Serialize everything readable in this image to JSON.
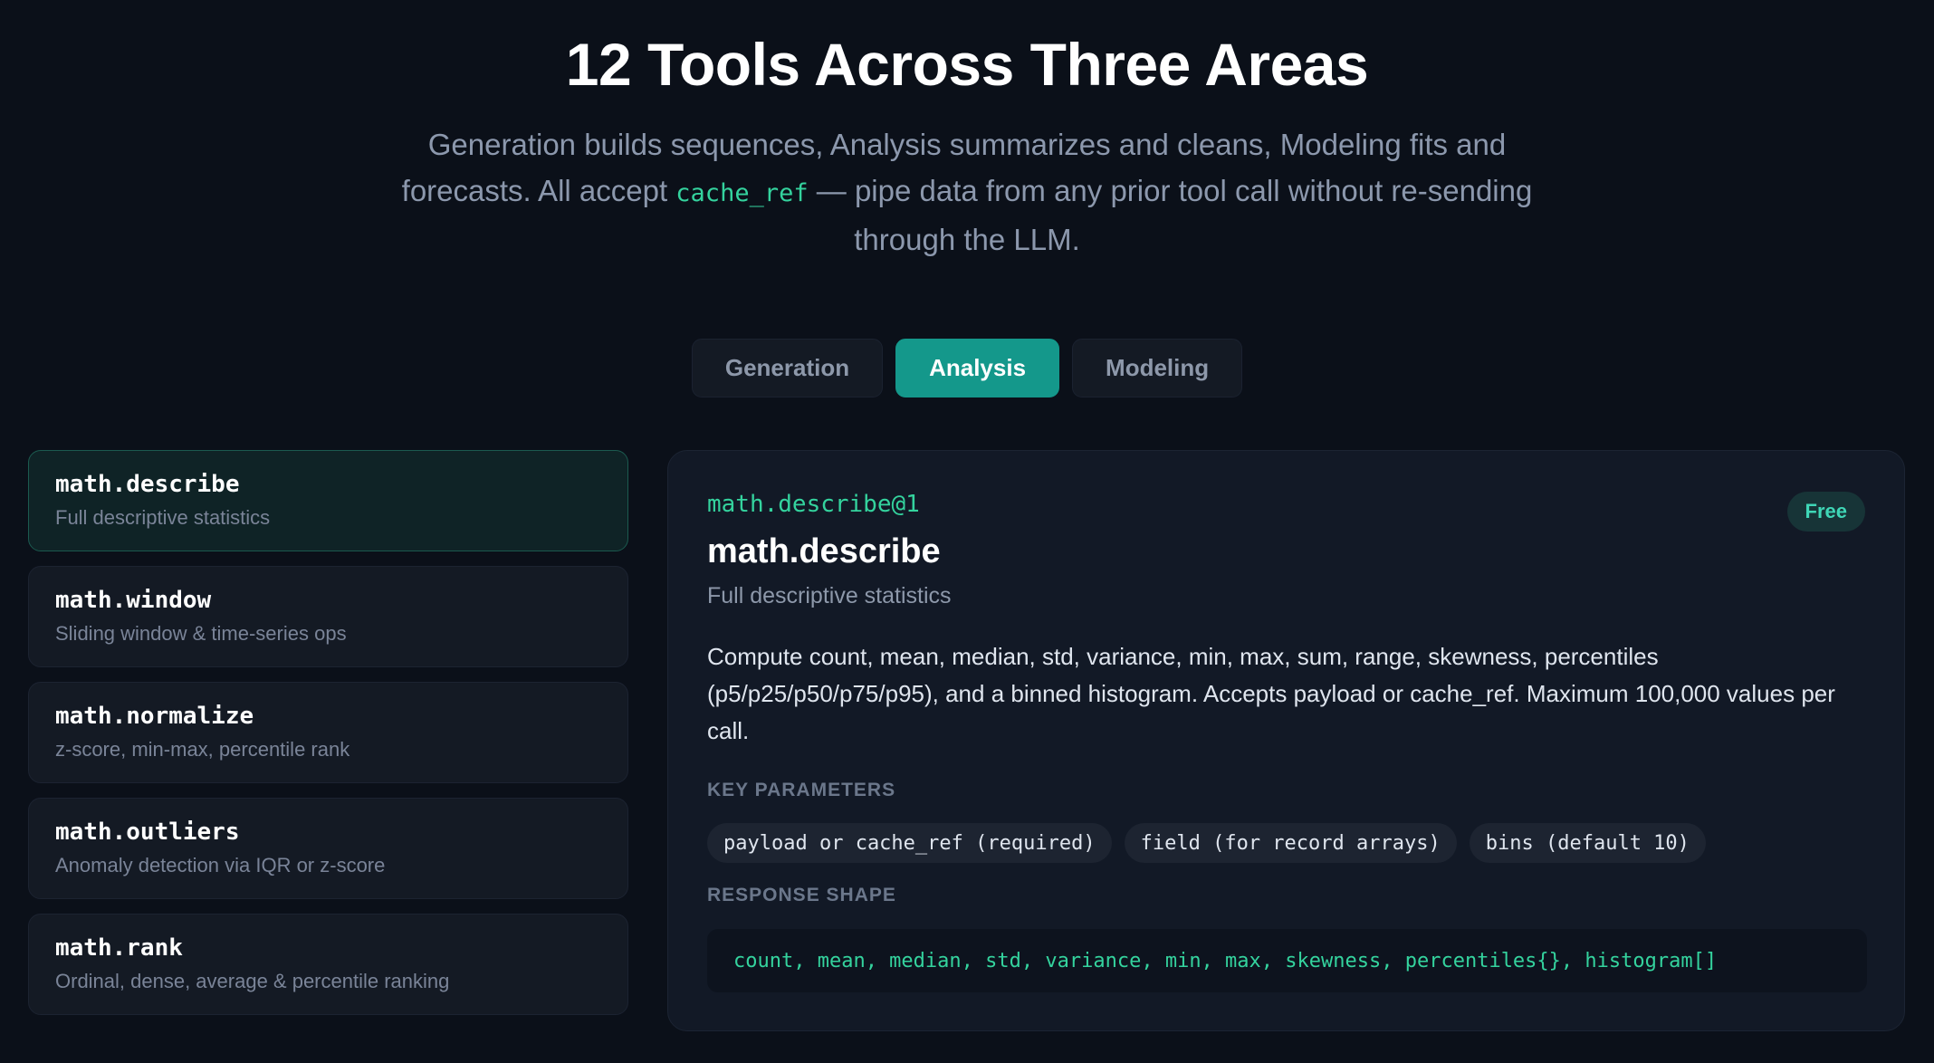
{
  "hero": {
    "title": "12 Tools Across Three Areas",
    "subtitle_before": "Generation builds sequences, Analysis summarizes and cleans, Modeling fits and forecasts. All accept ",
    "subtitle_code": "cache_ref",
    "subtitle_after": " — pipe data from any prior tool call without re-sending through the LLM."
  },
  "tabs": [
    {
      "label": "Generation",
      "active": false
    },
    {
      "label": "Analysis",
      "active": true
    },
    {
      "label": "Modeling",
      "active": false
    }
  ],
  "tools": [
    {
      "name": "math.describe",
      "desc": "Full descriptive statistics",
      "selected": true
    },
    {
      "name": "math.window",
      "desc": "Sliding window & time-series ops",
      "selected": false
    },
    {
      "name": "math.normalize",
      "desc": "z-score, min-max, percentile rank",
      "selected": false
    },
    {
      "name": "math.outliers",
      "desc": "Anomaly detection via IQR or z-score",
      "selected": false
    },
    {
      "name": "math.rank",
      "desc": "Ordinal, dense, average & percentile ranking",
      "selected": false
    }
  ],
  "detail": {
    "id": "math.describe@1",
    "badge": "Free",
    "title": "math.describe",
    "subtitle": "Full descriptive statistics",
    "body": "Compute count, mean, median, std, variance, min, max, sum, range, skewness, percentiles (p5/p25/p50/p75/p95), and a binned histogram. Accepts payload or cache_ref. Maximum 100,000 values per call.",
    "params_label": "KEY PARAMETERS",
    "params": [
      "payload or cache_ref (required)",
      "field (for record arrays)",
      "bins (default 10)"
    ],
    "response_label": "RESPONSE SHAPE",
    "response": "count, mean, median, std, variance, min, max, skewness, percentiles{}, histogram[]"
  },
  "colors": {
    "background": "#0b1019",
    "accent": "#14988b",
    "code_green": "#34d39e",
    "muted_text": "#8c98ad"
  }
}
